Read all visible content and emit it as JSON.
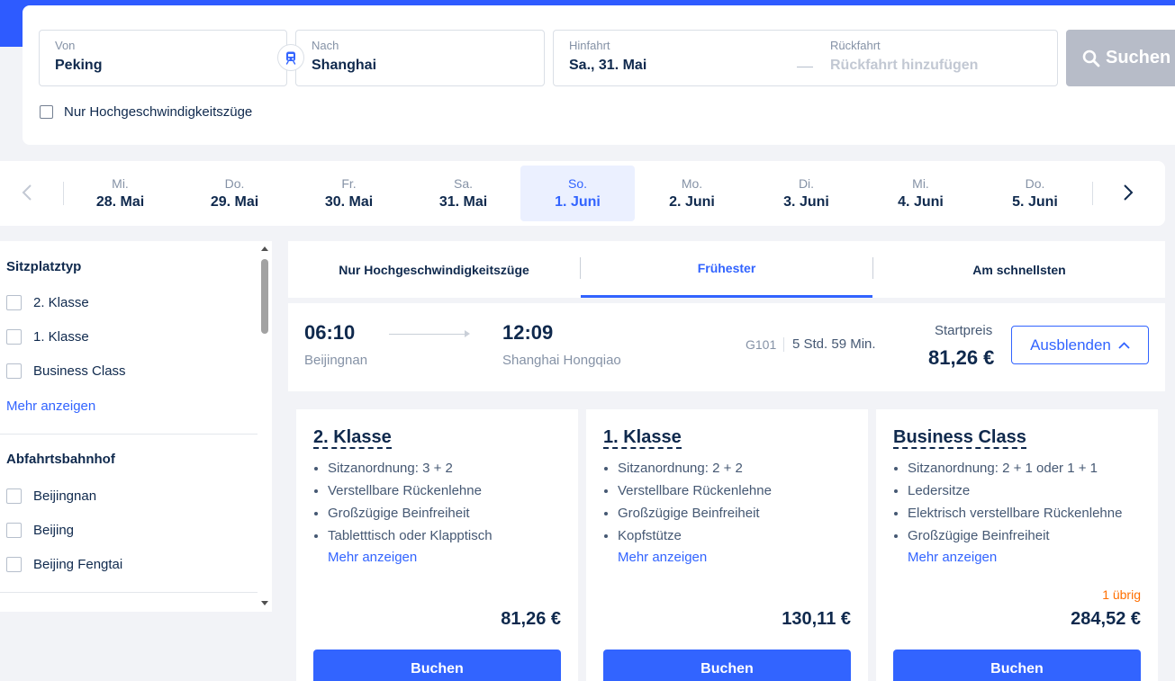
{
  "search": {
    "from_label": "Von",
    "from_value": "Peking",
    "to_label": "Nach",
    "to_value": "Shanghai",
    "depart_label": "Hinfahrt",
    "depart_value": "Sa., 31. Mai",
    "return_label": "Rückfahrt",
    "return_placeholder": "Rückfahrt hinzufügen",
    "search_button": "Suchen",
    "highspeed_only": "Nur Hochgeschwindigkeitszüge"
  },
  "dates": [
    {
      "weekday": "Mi.",
      "date": "28. Mai"
    },
    {
      "weekday": "Do.",
      "date": "29. Mai"
    },
    {
      "weekday": "Fr.",
      "date": "30. Mai"
    },
    {
      "weekday": "Sa.",
      "date": "31. Mai"
    },
    {
      "weekday": "So.",
      "date": "1. Juni",
      "selected": true
    },
    {
      "weekday": "Mo.",
      "date": "2. Juni"
    },
    {
      "weekday": "Di.",
      "date": "3. Juni"
    },
    {
      "weekday": "Mi.",
      "date": "4. Juni"
    },
    {
      "weekday": "Do.",
      "date": "5. Juni"
    }
  ],
  "filters": {
    "seat_type_title": "Sitzplatztyp",
    "seat_types": [
      "2. Klasse",
      "1. Klasse",
      "Business Class"
    ],
    "more_label": "Mehr anzeigen",
    "station_title": "Abfahrtsbahnhof",
    "stations": [
      "Beijingnan",
      "Beijing",
      "Beijing Fengtai"
    ]
  },
  "sort_tabs": [
    "Nur Hochgeschwindigkeitszüge",
    "Frühester",
    "Am schnellsten"
  ],
  "active_tab": "Frühester",
  "train": {
    "depart_time": "06:10",
    "depart_station": "Beijingnan",
    "arrive_time": "12:09",
    "arrive_station": "Shanghai Hongqiao",
    "train_number": "G101",
    "duration": "5 Std. 59 Min.",
    "start_price_label": "Startpreis",
    "start_price": "81,26 €",
    "hide_button": "Ausblenden"
  },
  "classes": [
    {
      "name": "2. Klasse",
      "features": [
        "Sitzanordnung: 3 + 2",
        "Verstellbare Rückenlehne",
        "Großzügige Beinfreiheit",
        "Tabletttisch oder Klapptisch"
      ],
      "more": "Mehr anzeigen",
      "remaining": "",
      "price": "81,26 €",
      "book": "Buchen"
    },
    {
      "name": "1. Klasse",
      "features": [
        "Sitzanordnung: 2 + 2",
        "Verstellbare Rückenlehne",
        "Großzügige Beinfreiheit",
        "Kopfstütze"
      ],
      "more": "Mehr anzeigen",
      "remaining": "",
      "price": "130,11 €",
      "book": "Buchen"
    },
    {
      "name": "Business Class",
      "features": [
        "Sitzanordnung: 2 + 1 oder 1 + 1",
        "Ledersitze",
        "Elektrisch verstellbare Rückenlehne",
        "Großzügige Beinfreiheit"
      ],
      "more": "Mehr anzeigen",
      "remaining": "1 übrig",
      "price": "284,52 €",
      "book": "Buchen"
    }
  ],
  "colors": {
    "accent": "#3264ff",
    "brand_band": "#2e5bff",
    "warning": "#ff6f00",
    "disabled_button": "#b7bcc8"
  },
  "icons": [
    "train-icon",
    "search-icon",
    "chevron-left-icon",
    "chevron-right-icon",
    "chevron-up-icon"
  ]
}
